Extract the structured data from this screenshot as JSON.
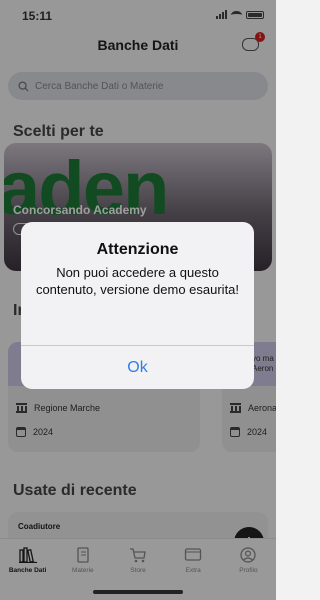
{
  "status_bar": {
    "time": "15:11"
  },
  "header": {
    "title": "Banche Dati",
    "notification_count": "1"
  },
  "search": {
    "placeholder": "Cerca Banche Dati o Materie"
  },
  "sections": {
    "scelti": "Scelti per te",
    "second_partial": "In",
    "usate": "Usate di recente"
  },
  "banner": {
    "big_text": "aden",
    "name": "Concorsando Academy"
  },
  "cards": [
    {
      "region": "Regione Marche",
      "year": "2024"
    },
    {
      "title_partial_1": "vo ma",
      "title_partial_2": "Aeron",
      "region": "Aerona",
      "year": "2024"
    }
  ],
  "recent": {
    "label": "Coadiutore"
  },
  "tabs": [
    {
      "label": "Banche Dati",
      "icon": "library-icon"
    },
    {
      "label": "Materie",
      "icon": "book-icon"
    },
    {
      "label": "Store",
      "icon": "cart-icon"
    },
    {
      "label": "Extra",
      "icon": "tv-icon"
    },
    {
      "label": "Profilo",
      "icon": "profile-icon"
    }
  ],
  "alert": {
    "title": "Attenzione",
    "message": "Non puoi accedere a questo contenuto, versione demo esaurita!",
    "ok_label": "Ok"
  },
  "colors": {
    "accent": "#2f7ee6",
    "badge": "#d62020",
    "brand_green": "#1e7a38"
  }
}
